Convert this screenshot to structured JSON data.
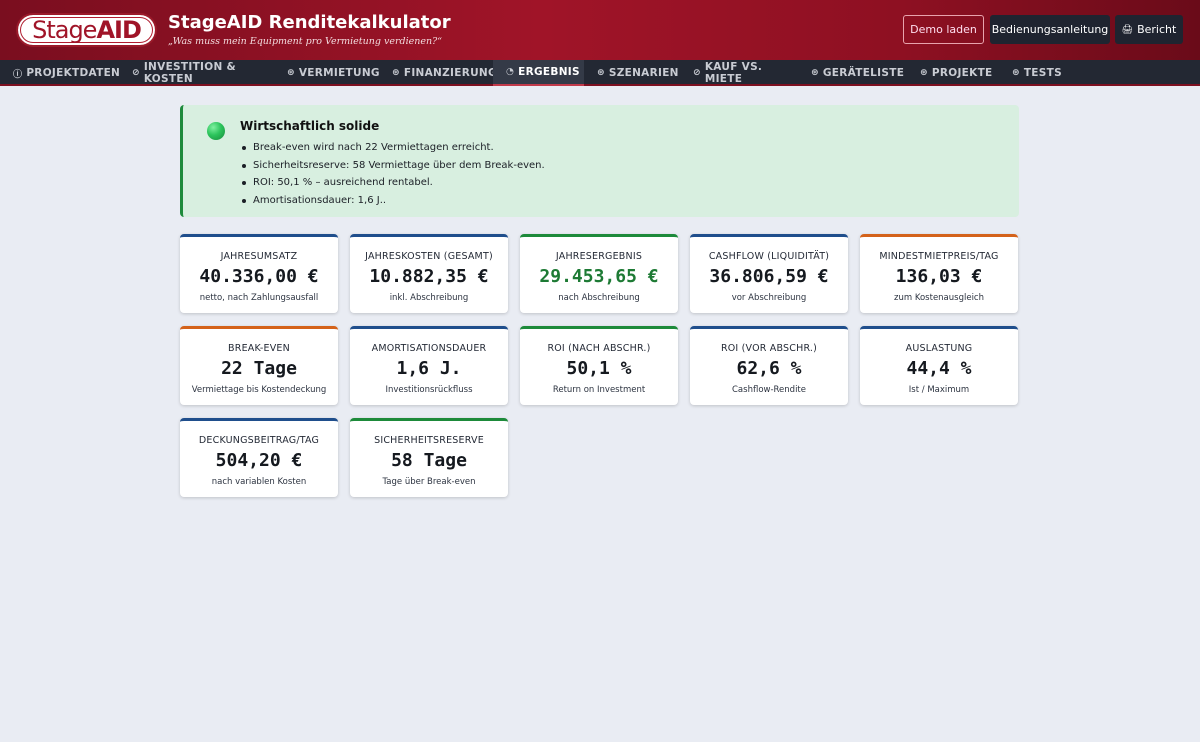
{
  "header": {
    "logo_part1": "Stage",
    "logo_part2": "AID",
    "title": "StageAID Renditekalkulator",
    "subtitle": "„Was muss mein Equipment pro Vermietung verdienen?“",
    "btn_demo": "Demo laden",
    "btn_manual": "Bedienungsanleitung",
    "btn_report": "Bericht",
    "btn_report_icon": "printer-icon",
    "accent_color": "#a01428"
  },
  "tabs": [
    {
      "label": "PROJEKTDATEN",
      "icon": "info-icon",
      "active": false
    },
    {
      "label": "INVESTITION & KOSTEN",
      "icon": "euro-icon",
      "active": false
    },
    {
      "label": "VERMIETUNG",
      "icon": "calendar-icon",
      "active": false
    },
    {
      "label": "FINANZIERUNG",
      "icon": "bank-icon",
      "active": false
    },
    {
      "label": "ERGEBNIS",
      "icon": "chart-icon",
      "active": true
    },
    {
      "label": "SZENARIEN",
      "icon": "layers-icon",
      "active": false
    },
    {
      "label": "KAUF VS. MIETE",
      "icon": "scale-icon",
      "active": false
    },
    {
      "label": "GERÄTELISTE",
      "icon": "list-icon",
      "active": false
    },
    {
      "label": "PROJEKTE",
      "icon": "folder-icon",
      "active": false
    },
    {
      "label": "TESTS",
      "icon": "check-icon",
      "active": false
    }
  ],
  "alert": {
    "title": "Wirtschaftlich solide",
    "status_color": "#1e8a3c",
    "items": [
      "Break-even wird nach 22 Vermiettagen erreicht.",
      "Sicherheitsreserve: 58 Vermiettage über dem Break-even.",
      "ROI: 50,1 % – ausreichend rentabel.",
      "Amortisationsdauer: 1,6 J.."
    ]
  },
  "cards": [
    {
      "label": "JAHRESUMSATZ",
      "value": "40.336,00 €",
      "sub": "netto, nach Zahlungsausfall",
      "accent": "blue",
      "positive": false
    },
    {
      "label": "JAHRESKOSTEN (GESAMT)",
      "value": "10.882,35 €",
      "sub": "inkl. Abschreibung",
      "accent": "blue",
      "positive": false
    },
    {
      "label": "JAHRESERGEBNIS",
      "value": "29.453,65 €",
      "sub": "nach Abschreibung",
      "accent": "green",
      "positive": true
    },
    {
      "label": "CASHFLOW (LIQUIDITÄT)",
      "value": "36.806,59 €",
      "sub": "vor Abschreibung",
      "accent": "blue",
      "positive": false
    },
    {
      "label": "MINDESTMIETPREIS/TAG",
      "value": "136,03 €",
      "sub": "zum Kostenausgleich",
      "accent": "orange",
      "positive": false
    },
    {
      "label": "BREAK-EVEN",
      "value": "22 Tage",
      "sub": "Vermiettage bis Kostendeckung",
      "accent": "orange",
      "positive": false
    },
    {
      "label": "AMORTISATIONSDAUER",
      "value": "1,6 J.",
      "sub": "Investitionsrückfluss",
      "accent": "blue",
      "positive": false
    },
    {
      "label": "ROI (NACH ABSCHR.)",
      "value": "50,1 %",
      "sub": "Return on Investment",
      "accent": "green",
      "positive": false
    },
    {
      "label": "ROI (VOR ABSCHR.)",
      "value": "62,6 %",
      "sub": "Cashflow-Rendite",
      "accent": "blue",
      "positive": false
    },
    {
      "label": "AUSLASTUNG",
      "value": "44,4 %",
      "sub": "Ist / Maximum",
      "accent": "blue",
      "positive": false
    },
    {
      "label": "DECKUNGSBEITRAG/TAG",
      "value": "504,20 €",
      "sub": "nach variablen Kosten",
      "accent": "blue",
      "positive": false
    },
    {
      "label": "SICHERHEITSRESERVE",
      "value": "58 Tage",
      "sub": "Tage über Break-even",
      "accent": "green",
      "positive": false
    }
  ]
}
